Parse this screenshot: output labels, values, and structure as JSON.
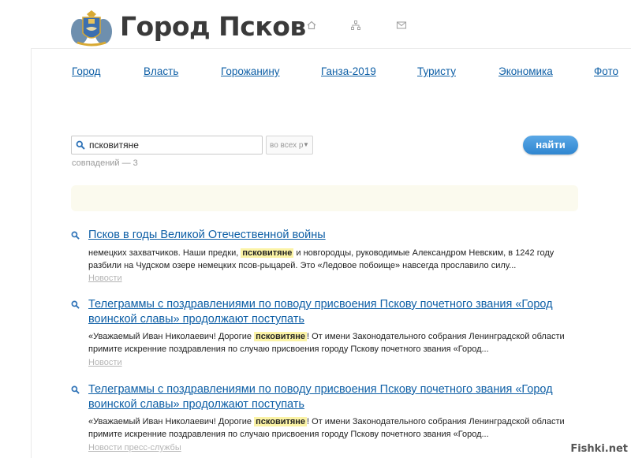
{
  "header": {
    "site_title": "Город Псков",
    "icons": [
      "home-icon",
      "sitemap-icon",
      "mail-icon"
    ]
  },
  "nav": {
    "items": [
      {
        "label": "Город"
      },
      {
        "label": "Власть"
      },
      {
        "label": "Горожанину"
      },
      {
        "label": "Ганза-2019"
      },
      {
        "label": "Туристу"
      },
      {
        "label": "Экономика"
      },
      {
        "label": "Фото"
      }
    ]
  },
  "search": {
    "query": "псковитяне",
    "scope": "во всех р",
    "button_label": "найти",
    "matches_text": "совпадений — 3"
  },
  "results": [
    {
      "title": "Псков в годы Великой Отечественной войны",
      "snippet_before": "немецких захватчиков. Наши предки, ",
      "snippet_highlight": "псковитяне",
      "snippet_after": " и новгородцы, руководимые Александром Невским, в 1242 году разбили на Чудском озере немецких псов-рыцарей. Это «Ледовое побоище» навсегда прославило силу...",
      "category": "Новости"
    },
    {
      "title": "Телеграммы с поздравлениями по поводу присвоения Пскову почетного звания «Город воинской славы» продолжают поступать",
      "snippet_before": "«Уважаемый Иван Николаевич! Дорогие ",
      "snippet_highlight": "псковитяне",
      "snippet_after": "! От имени Законодательного собрания Ленинградской области примите искренние поздравления по случаю присвоения городу Пскову почетного звания «Город...",
      "category": "Новости"
    },
    {
      "title": "Телеграммы с поздравлениями по поводу присвоения Пскову почетного звания «Город воинской славы» продолжают поступать",
      "snippet_before": "«Уважаемый Иван Николаевич! Дорогие ",
      "snippet_highlight": "псковитяне",
      "snippet_after": "! От имени Законодательного собрания Ленинградской области примите искренние поздравления по случаю присвоения городу Пскову почетного звания «Город...",
      "category": "Новости пресс-службы"
    }
  ],
  "watermark": "Fishki.net",
  "colors": {
    "link": "#0e5fa6",
    "button": "#3a93da",
    "highlight": "#fbf3a5",
    "notice_band": "#fbfaee"
  }
}
